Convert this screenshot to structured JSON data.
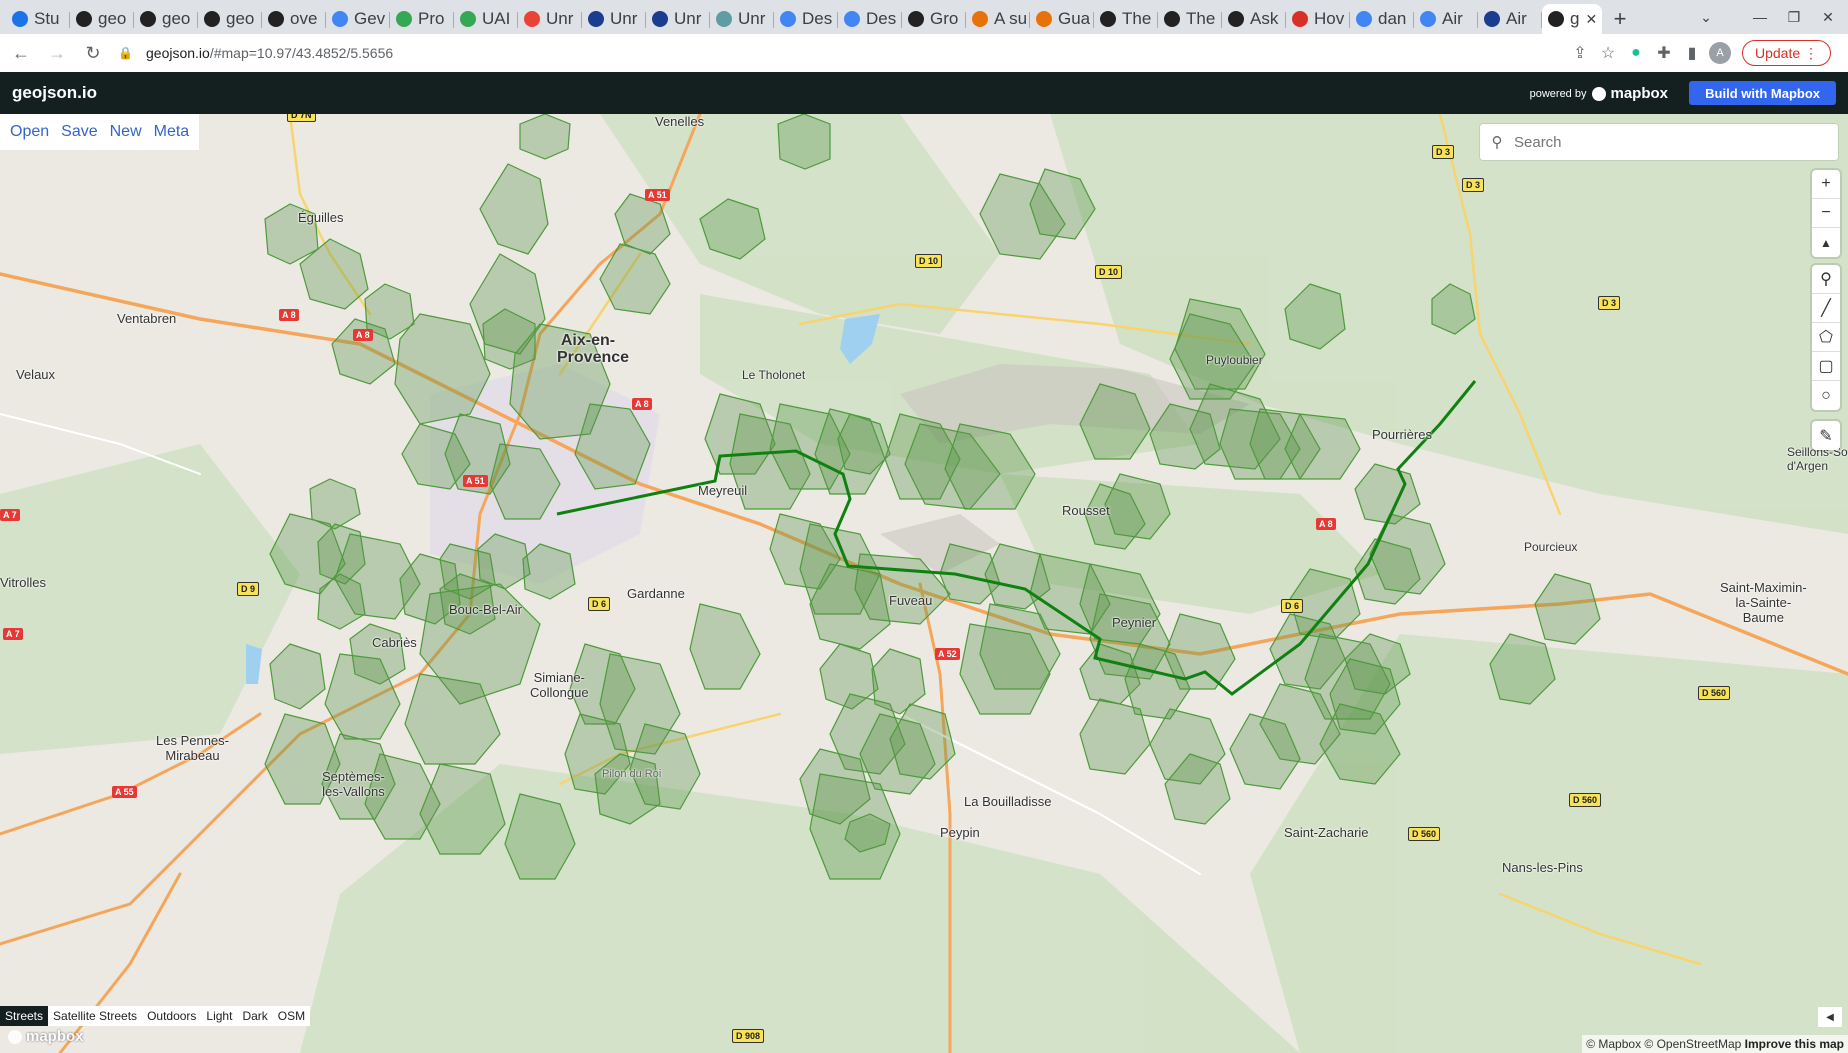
{
  "browser": {
    "tabs": [
      {
        "label": "Stu",
        "color": "#1a73e8"
      },
      {
        "label": "geo",
        "color": "#222"
      },
      {
        "label": "geo",
        "color": "#222"
      },
      {
        "label": "geo",
        "color": "#222"
      },
      {
        "label": "ove",
        "color": "#222"
      },
      {
        "label": "Gev",
        "color": "#4285f4"
      },
      {
        "label": "Pro",
        "color": "#34a853"
      },
      {
        "label": "UAI",
        "color": "#34a853"
      },
      {
        "label": "Unr",
        "color": "#ea4335"
      },
      {
        "label": "Unr",
        "color": "#1a3d8f"
      },
      {
        "label": "Unr",
        "color": "#1a3d8f"
      },
      {
        "label": "Unr",
        "color": "#5f9ea0"
      },
      {
        "label": "Des",
        "color": "#4285f4"
      },
      {
        "label": "Des",
        "color": "#4285f4"
      },
      {
        "label": "Gro",
        "color": "#222"
      },
      {
        "label": "A su",
        "color": "#e8710a"
      },
      {
        "label": "Gua",
        "color": "#e8710a"
      },
      {
        "label": "The",
        "color": "#222"
      },
      {
        "label": "The",
        "color": "#222"
      },
      {
        "label": "Ask",
        "color": "#222"
      },
      {
        "label": "Hov",
        "color": "#d93025"
      },
      {
        "label": "dan",
        "color": "#4285f4"
      },
      {
        "label": "Air",
        "color": "#4285f4"
      },
      {
        "label": "Air",
        "color": "#1a3d8f"
      }
    ],
    "active_tab": {
      "label": "g",
      "color": "#222"
    },
    "url_host": "geojson.io",
    "url_path": "/#map=10.97/43.4852/5.5656",
    "update_label": "Update",
    "avatar_letter": "A"
  },
  "app": {
    "brand": "geojson.io",
    "powered_by": "powered by",
    "mapbox_label": "mapbox",
    "build_button": "Build with Mapbox",
    "menu": [
      "Open",
      "Save",
      "New",
      "Meta"
    ],
    "search_placeholder": "Search"
  },
  "map": {
    "layers": [
      "Streets",
      "Satellite Streets",
      "Outdoors",
      "Light",
      "Dark",
      "OSM"
    ],
    "active_layer": "Streets",
    "logo": "mapbox",
    "attribution": "© Mapbox © OpenStreetMap",
    "improve": "Improve this map",
    "places": {
      "venelles": "Venelles",
      "eguilles": "Éguilles",
      "ventabren": "Ventabren",
      "velaux": "Velaux",
      "aix_1": "Aix-en-",
      "aix_2": "Provence",
      "tholonet": "Le Tholonet",
      "puyloubier": "Puyloubier",
      "pourrieres": "Pourrières",
      "meyreuil": "Meyreuil",
      "rousset": "Rousset",
      "seillons_1": "Seillons-So",
      "seillons_2": "d'Argen",
      "pourcieux": "Pourcieux",
      "vitrolles": "Vitrolles",
      "boucbelair": "Bouc-Bel-Air",
      "gardanne": "Gardanne",
      "fuveau": "Fuveau",
      "peynier": "Peynier",
      "saintmax_1": "Saint-Maximin-",
      "saintmax_2": "la-Sainte-",
      "saintmax_3": "Baume",
      "cabries": "Cabriès",
      "simiane_1": "Simiane-",
      "simiane_2": "Collongue",
      "pennes_1": "Les Pennes-",
      "pennes_2": "Mirabeau",
      "septemes_1": "Septèmes-",
      "septemes_2": "les-Vallons",
      "pilon": "Pilon du Roi",
      "bouilladisse": "La Bouilladisse",
      "peypin": "Peypin",
      "saintzach": "Saint-Zacharie",
      "nans": "Nans-les-Pins"
    },
    "roads": {
      "d7n": "D 7N",
      "a51a": "A 51",
      "d3a": "D 3",
      "d3b": "D 3",
      "d10a": "D 10",
      "d10b": "D 10",
      "d3c": "D 3",
      "a8a": "A 8",
      "a8b": "A 8",
      "a8c": "A 8",
      "a51b": "A 51",
      "a8d": "A 8",
      "a7a": "A 7",
      "a7b": "A 7",
      "d9": "D 9",
      "d6a": "D 6",
      "d6b": "D 6",
      "a52": "A 52",
      "d560a": "D 560",
      "d560b": "D 560",
      "d560c": "D 560",
      "a55": "A 55",
      "d908": "D 908"
    }
  }
}
